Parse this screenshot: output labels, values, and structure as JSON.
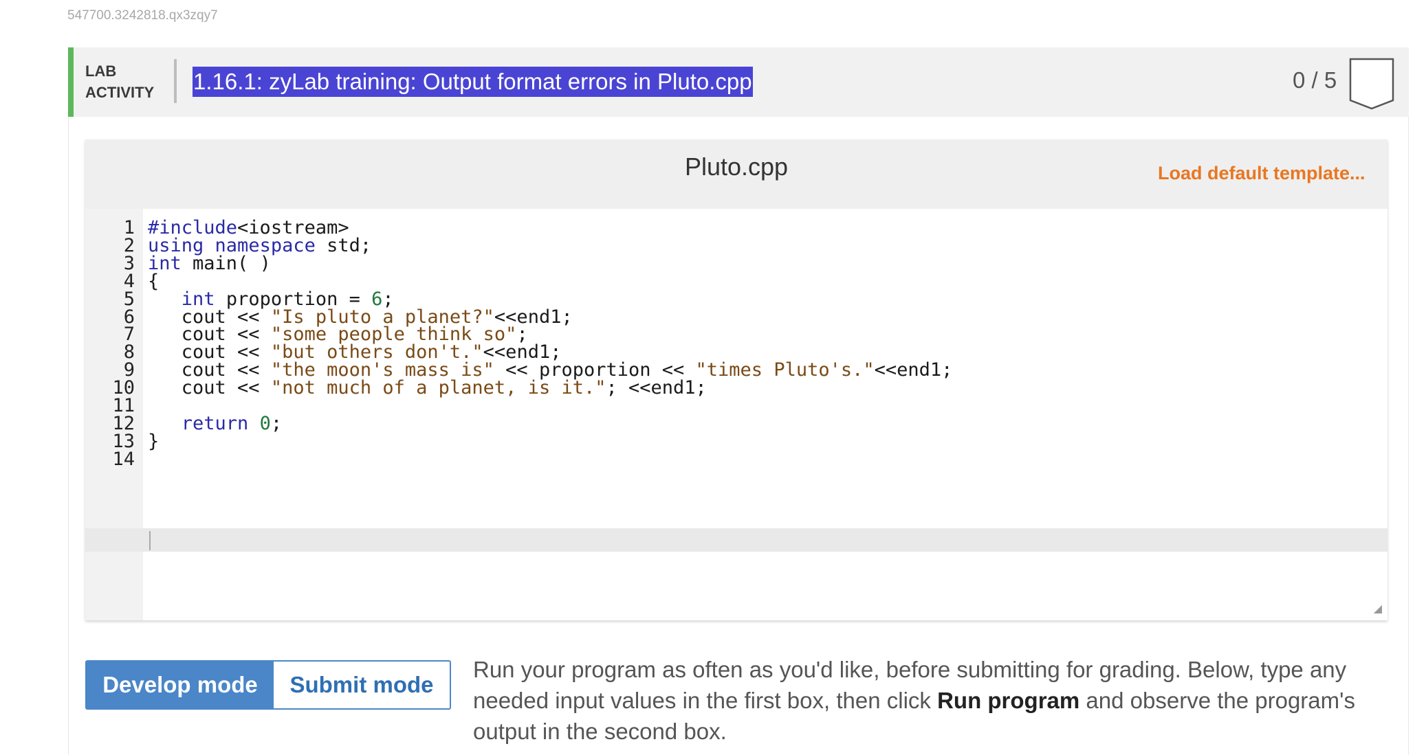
{
  "page": {
    "id_text": "547700.3242818.qx3zqy7"
  },
  "lab": {
    "label_line1": "LAB",
    "label_line2": "ACTIVITY",
    "title": "1.16.1: zyLab training: Output format errors in Pluto.cpp",
    "score": "0 / 5",
    "accent_color": "#5cb85c"
  },
  "editor": {
    "file_name": "Pluto.cpp",
    "load_template_label": "Load default template...",
    "lines": [
      {
        "n": "1",
        "text": "#include<iostream>"
      },
      {
        "n": "2",
        "text": "using namespace std;"
      },
      {
        "n": "3",
        "text": "int main( )"
      },
      {
        "n": "4",
        "text": "{"
      },
      {
        "n": "5",
        "text": "   int proportion = 6;"
      },
      {
        "n": "6",
        "text": "   cout << \"Is pluto a planet?\"<<end1;"
      },
      {
        "n": "7",
        "text": "   cout << \"some people think so\";"
      },
      {
        "n": "8",
        "text": "   cout << \"but others don't.\"<<end1;"
      },
      {
        "n": "9",
        "text": "   cout << \"the moon's mass is\" << proportion << \"times Pluto's.\"<<end1;"
      },
      {
        "n": "10",
        "text": "   cout << \"not much of a planet, is it.\"; <<end1;"
      },
      {
        "n": "11",
        "text": ""
      },
      {
        "n": "12",
        "text": "   return 0;"
      },
      {
        "n": "13",
        "text": "}"
      },
      {
        "n": "14",
        "text": ""
      }
    ],
    "resize_icon": "resize-handle-icon"
  },
  "modes": {
    "develop_label": "Develop mode",
    "submit_label": "Submit mode",
    "active": "Develop mode",
    "active_color": "#4a86c8"
  },
  "instructions": {
    "part1": "Run your program as often as you'd like, before submitting for grading. Below, type any needed input values in the first box, then click ",
    "bold": "Run program",
    "part2": " and observe the program's output in the second box."
  }
}
